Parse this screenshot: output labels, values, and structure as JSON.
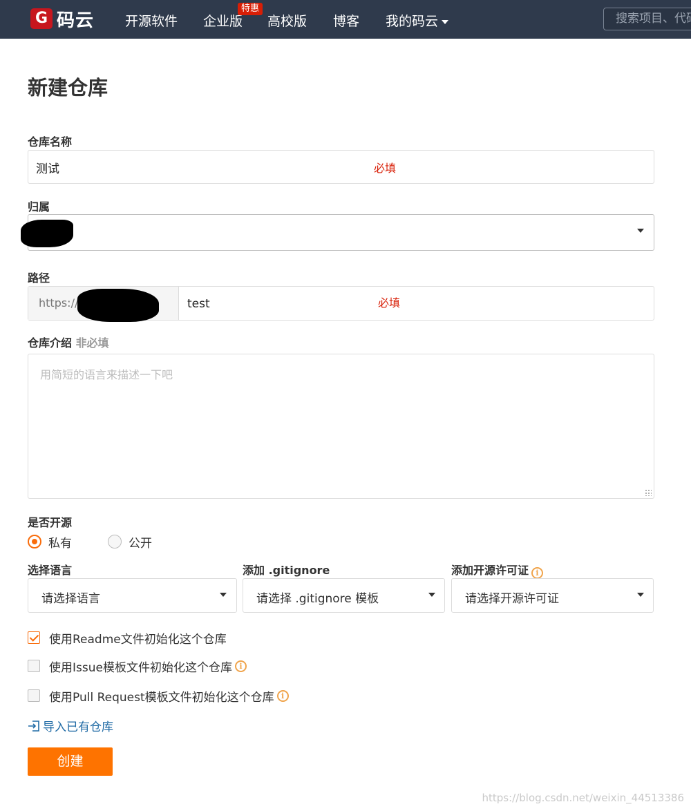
{
  "nav": {
    "logo_mark": "G",
    "logo_text": "码云",
    "items": [
      "开源软件",
      "企业版",
      "高校版",
      "博客",
      "我的码云"
    ],
    "badge": "特惠",
    "search_placeholder": "搜索项目、代码"
  },
  "page": {
    "title": "新建仓库"
  },
  "form": {
    "repo_name": {
      "label": "仓库名称",
      "value": "测试",
      "required_note": "必填"
    },
    "owner": {
      "label": "归属"
    },
    "path": {
      "label": "路径",
      "prefix": "https://",
      "value": "test",
      "required_note": "必填"
    },
    "description": {
      "label": "仓库介绍",
      "optional": "非必填",
      "placeholder": "用简短的语言来描述一下吧"
    },
    "visibility": {
      "label": "是否开源",
      "options": [
        "私有",
        "公开"
      ],
      "selected": "私有"
    },
    "language": {
      "label": "选择语言",
      "value": "请选择语言"
    },
    "gitignore": {
      "label": "添加 .gitignore",
      "value": "请选择 .gitignore 模板"
    },
    "license": {
      "label": "添加开源许可证",
      "value": "请选择开源许可证"
    },
    "checkboxes": [
      {
        "label": "使用Readme文件初始化这个仓库",
        "checked": true
      },
      {
        "label": "使用Issue模板文件初始化这个仓库",
        "checked": false
      },
      {
        "label": "使用Pull Request模板文件初始化这个仓库",
        "checked": false
      }
    ],
    "import_link": "导入已有仓库",
    "submit": "创建"
  },
  "watermark": "https://blog.csdn.net/weixin_44513386",
  "colors": {
    "nav_bg": "#2f3a4c",
    "accent": "#fe7300",
    "required": "#d81e06",
    "link": "#1f6aa5"
  }
}
